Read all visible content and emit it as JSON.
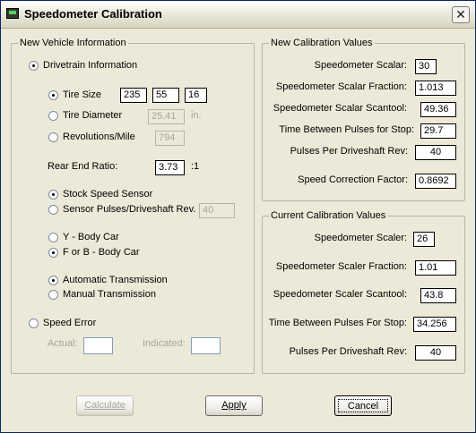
{
  "window": {
    "title": "Speedometer Calibration",
    "close_glyph": "✕"
  },
  "new_vehicle": {
    "title": "New Vehicle Information",
    "drivetrain_label": "Drivetrain Information",
    "tire_size_label": "Tire Size",
    "tire_size_values": [
      "235",
      "55",
      "16"
    ],
    "tire_diameter_label": "Tire Diameter",
    "tire_diameter_value": "25.41",
    "tire_diameter_unit": "in.",
    "revs_label": "Revolutions/Mile",
    "revs_value": "794",
    "rear_end_label": "Rear End Ratio:",
    "rear_end_value": "3.73",
    "rear_end_unit": ":1",
    "stock_sensor_label": "Stock Speed Sensor",
    "sensor_pulses_label": "Sensor Pulses/Driveshaft Rev.",
    "sensor_pulses_value": "40",
    "y_body_label": "Y - Body Car",
    "f_b_body_label": "F or B - Body Car",
    "auto_trans_label": "Automatic Transmission",
    "manual_trans_label": "Manual Transmission",
    "speed_error_label": "Speed Error",
    "actual_label": "Actual:",
    "actual_value": "",
    "indicated_label": "Indicated:",
    "indicated_value": ""
  },
  "new_calibration": {
    "title": "New Calibration Values",
    "rows": [
      {
        "label": "Speedometer Scalar:",
        "value": "30"
      },
      {
        "label": "Speedometer Scalar Fraction:",
        "value": "1.013"
      },
      {
        "label": "Speedometer Scalar Scantool:",
        "value": "49.36"
      },
      {
        "label": "Time Between Pulses for Stop:",
        "value": "29.7"
      },
      {
        "label": "Pulses Per Driveshaft Rev:",
        "value": "40"
      },
      {
        "label": "Speed Correction Factor:",
        "value": "0.8692"
      }
    ]
  },
  "current_calibration": {
    "title": "Current Calibration Values",
    "rows": [
      {
        "label": "Speedometer Scaler:",
        "value": "26"
      },
      {
        "label": "Speedometer Scaler Fraction:",
        "value": "1.01"
      },
      {
        "label": "Speedometer Scaler Scantool:",
        "value": "43.8"
      },
      {
        "label": "Time Between Pulses For Stop:",
        "value": "34.256"
      },
      {
        "label": "Pulses Per Driveshaft Rev:",
        "value": "40"
      }
    ]
  },
  "buttons": {
    "calculate": "Calculate",
    "apply": "Apply",
    "cancel": "Cancel"
  }
}
